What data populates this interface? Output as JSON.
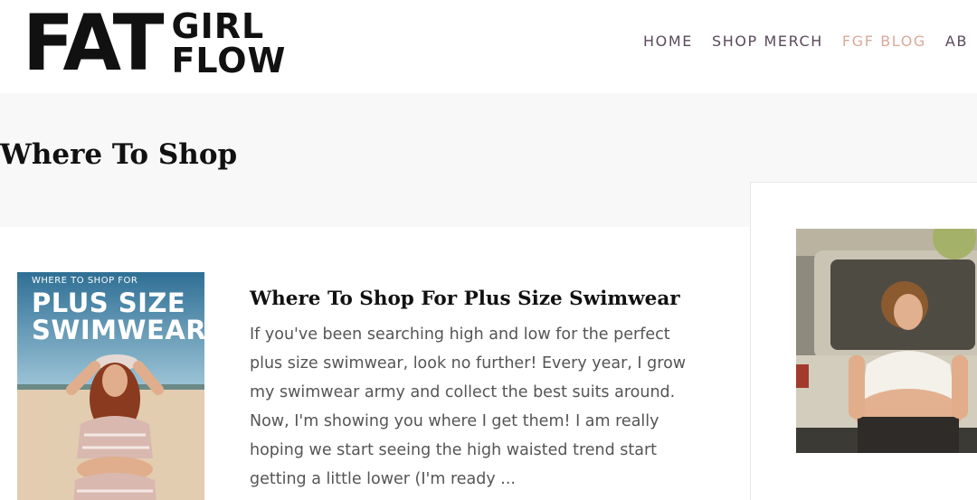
{
  "brand": {
    "logo_big": "FAT",
    "logo_line1": "GIRL",
    "logo_line2": "FLOW"
  },
  "nav": {
    "items": [
      {
        "label": "HOME"
      },
      {
        "label": "SHOP MERCH"
      },
      {
        "label": "FGF BLOG",
        "active": true
      },
      {
        "label": "AB"
      }
    ]
  },
  "page": {
    "title": "Where To Shop"
  },
  "post": {
    "thumb_kicker": "WHERE TO SHOP FOR",
    "thumb_title_line1": "PLUS SIZE",
    "thumb_title_line2": "SWIMWEAR",
    "title": "Where To Shop For Plus Size Swimwear",
    "excerpt": "If you've been searching high and low for the perfect plus size swimwear, look no further! Every year, I grow my swimwear army and collect the best suits around. Now, I'm showing you where I get them! I am really hoping we start seeing the high waisted trend start getting a little lower (I'm ready ..."
  },
  "colors": {
    "nav_text": "#5a4a5a",
    "nav_active": "#d9a99a",
    "title_band": "#f8f8f8"
  }
}
